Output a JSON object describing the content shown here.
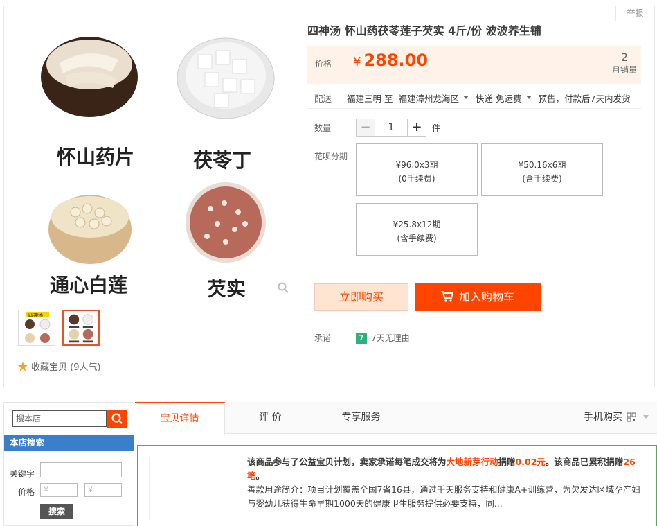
{
  "report": "举报",
  "product": {
    "title": "四神汤 怀山药茯苓莲子芡实 4斤/份 波波养生铺",
    "image_labels": [
      "怀山药片",
      "茯苓丁",
      "通心白莲",
      "芡实"
    ],
    "thumb_label": "四神汤",
    "favorite": "收藏宝贝 (9人气)"
  },
  "price": {
    "label": "价格",
    "currency": "¥",
    "value": "288.00",
    "sales_count": "2",
    "sales_label": "月销量"
  },
  "shipping": {
    "label": "配送",
    "from": "福建三明 至",
    "to": "福建漳州龙海区",
    "method": "快递 免运费",
    "presale": "预售，付款后7天内发货"
  },
  "quantity": {
    "label": "数量",
    "minus": "−",
    "value": "1",
    "plus": "+",
    "unit": "件"
  },
  "huabei": {
    "label": "花呗分期",
    "plans": [
      {
        "amount": "¥96.0x3期",
        "fee": "(0手续费)"
      },
      {
        "amount": "¥50.16x6期",
        "fee": "(含手续费)"
      },
      {
        "amount": "¥25.8x12期",
        "fee": "(含手续费)"
      }
    ]
  },
  "actions": {
    "buy_now": "立即购买",
    "add_cart": "加入购物车"
  },
  "promise": {
    "label": "承诺",
    "badge": "7",
    "text": "7天无理由"
  },
  "sidebar": {
    "search_placeholder": "搜本店",
    "title": "本店搜索",
    "keyword_label": "关键字",
    "price_label": "价格",
    "price_min": "¥",
    "price_max": "¥",
    "search_button": "搜索"
  },
  "tabs": {
    "items": [
      "宝贝详情",
      "评 价",
      "专享服务"
    ],
    "mobile": "手机购买"
  },
  "charity": {
    "line1_a": "该商品参与了公益宝贝计划，卖家承诺每笔成交将为",
    "line1_org": "大地新芽行动",
    "line1_b": "捐赠",
    "line1_amt": "0.02元",
    "line1_c": "。该商品已累积捐赠",
    "line1_count": "26笔",
    "line1_d": "。",
    "line2": "善款用途简介：项目计划覆盖全国7省16县，通过千天服务支持和健康A+训练营，为欠发达区域孕产妇与婴幼儿获得生命早期1000天的健康卫生服务提供必要支持，同..."
  },
  "colors": {
    "accent": "#ff4400",
    "blue": "#3a7fcc",
    "green": "#4caf50"
  }
}
